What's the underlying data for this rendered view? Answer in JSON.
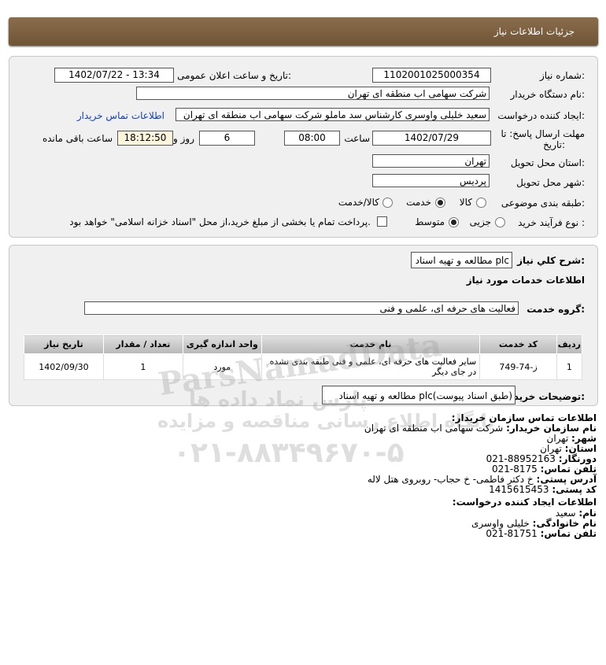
{
  "header": {
    "title": "جزئیات اطلاعات نیاز"
  },
  "form": {
    "need_number_label": "شماره نیاز:",
    "need_number": "1102001025000354",
    "announce_label": "تاریخ و ساعت اعلان عمومی:",
    "announce_value": "1402/07/22 - 13:34",
    "buyer_org_label": "نام دستگاه خریدار:",
    "buyer_org": "شرکت سهامی اب منطقه ای تهران",
    "creator_label": "ایجاد کننده درخواست:",
    "creator": "سعید خلیلی واوسری کارشناس سد ماملو شرکت سهامی اب منطقه ای تهران",
    "contact_link": "اطلاعات تماس خریدار",
    "deadline_label_1": "مهلت ارسال پاسخ: تا",
    "deadline_label_2": "تاریخ:",
    "deadline_date": "1402/07/29",
    "hour_label": "ساعت",
    "deadline_time": "08:00",
    "days_value": "6",
    "days_label": "روز و",
    "remaining_time": "18:12:50",
    "remaining_label": "ساعت باقی مانده",
    "province_label": "استان محل تحویل:",
    "province": "تهران",
    "city_label": "شهر محل تحویل:",
    "city": "پردیس",
    "category_label": "طبقه بندی موضوعی:",
    "category_options": [
      "کالا",
      "خدمت",
      "کالا/خدمت"
    ],
    "category_selected": "خدمت",
    "process_label": "نوع فرآیند خرید :",
    "process_options": [
      "جزیی",
      "متوسط"
    ],
    "process_selected": "متوسط",
    "payment_note": "پرداخت تمام یا بخشی از مبلغ خرید،از محل \"اسناد خزانه اسلامی\" خواهد بود."
  },
  "details": {
    "summary_label": "شرح کلي نياز:",
    "summary": "مطالعه و تهیه اسناد plc",
    "services_title": "اطلاعات خدمات مورد نیاز",
    "group_label": "گروه خدمت:",
    "group": "فعالیت های حرفه ای، علمی و فنی",
    "table": {
      "headers": [
        "ردیف",
        "کد خدمت",
        "نام خدمت",
        "واحد اندازه گیری",
        "تعداد / مقدار",
        "تاریخ نیاز"
      ],
      "rows": [
        {
          "row": "1",
          "code": "ز-74-749",
          "name": "سایر فعالیت های حرفه ای، علمی و فنی طبقه بندی نشده در جای دیگر",
          "unit": "مورد",
          "qty": "1",
          "date": "1402/09/30"
        }
      ]
    },
    "notes_label": "توضیحات خریدار:",
    "notes": "مطالعه و تهیه اسناد plc(طبق اسناد پیوست)"
  },
  "contact": {
    "org_title": "اطلاعات تماس سازمان خریدار:",
    "org_name_label": "نام سازمان خریدار:",
    "org_name": "شرکت سهامی اب منطقه ای تهران",
    "city_label": "شهر:",
    "city": "تهران",
    "province_label": "استان:",
    "province": "تهران",
    "fax_label": "دورنگار:",
    "fax": "021-88952163",
    "phone_label": "تلفن تماس:",
    "phone": "021-8175",
    "address_label": "آدرس پستی:",
    "address": "خ دکتر فاطمی- خ حجاب- روبروی هتل لاله",
    "postal_label": "کد پستی:",
    "postal": "1415615453",
    "creator_title": "اطلاعات ایجاد کننده درخواست:",
    "first_name_label": "نام:",
    "first_name": "سعید",
    "last_name_label": "نام خانوادگی:",
    "last_name": "خلیلی واوسری",
    "creator_phone_label": "تلفن تماس:",
    "creator_phone": "021-81751"
  },
  "watermark": {
    "brand": "ParsNamadData",
    "line1": "پارس نماد داده ها",
    "line2": "پایگاه اطلاع رسانی مناقصه و مزایده",
    "phone": "۰۲۱-۸۸۳۴۹۶۷۰-۵"
  }
}
